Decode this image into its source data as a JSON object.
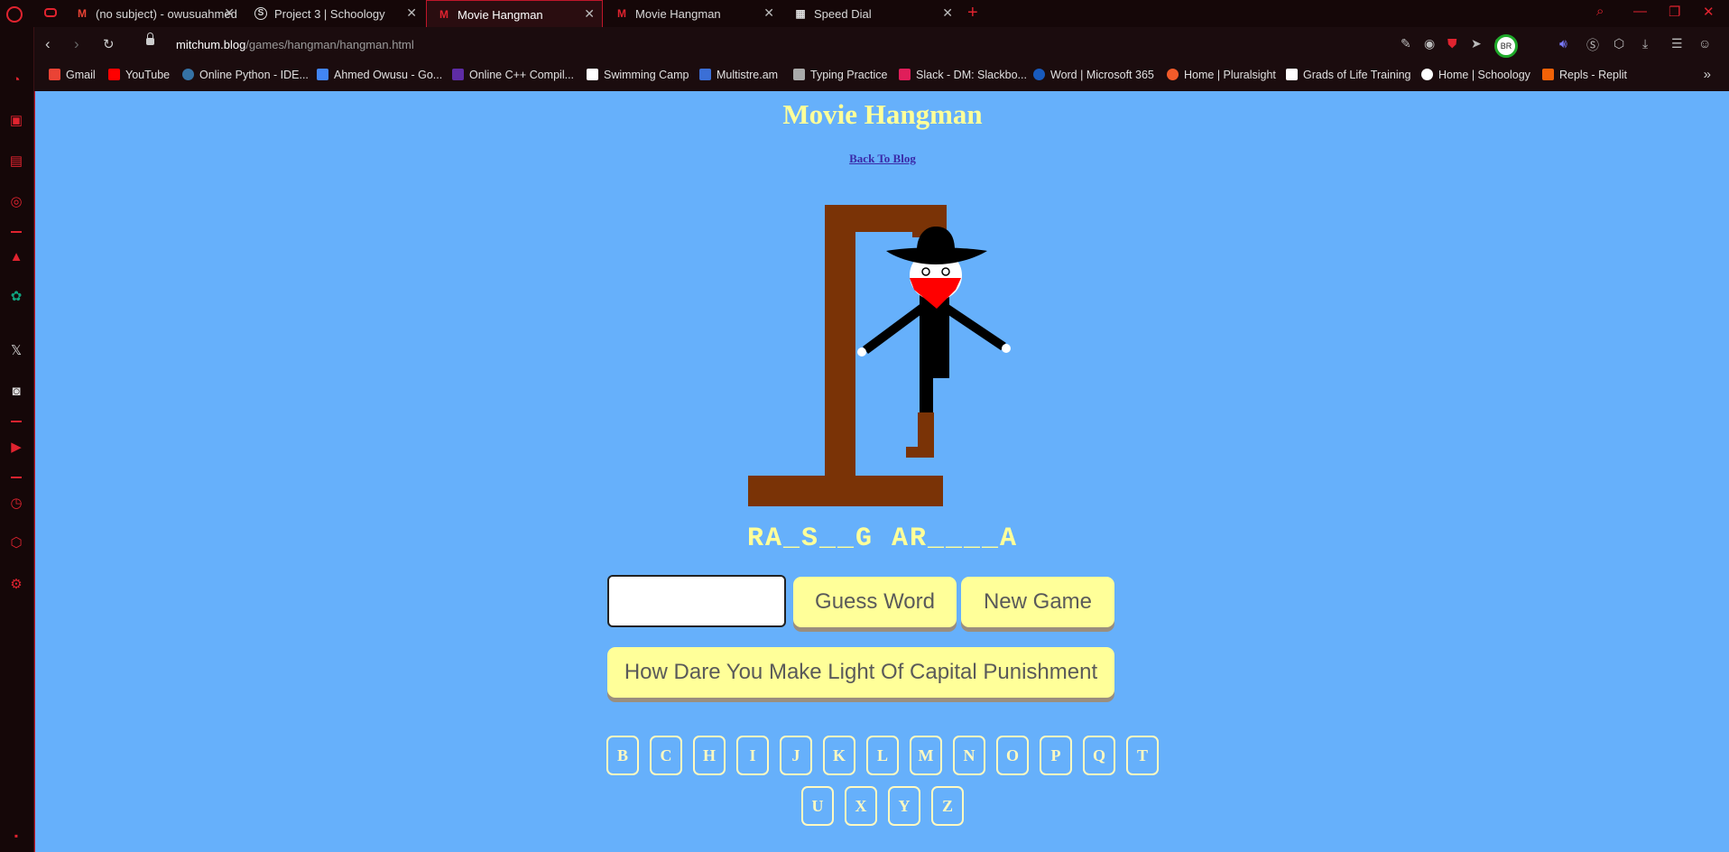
{
  "browser": {
    "tabs": [
      {
        "title": "(no subject) - owusuahmed",
        "icon": "gmail-icon",
        "active": false
      },
      {
        "title": "Project 3 | Schoology",
        "icon": "schoology-icon",
        "active": false
      },
      {
        "title": "Movie Hangman",
        "icon": "hangman-favicon",
        "active": true
      },
      {
        "title": "Movie Hangman",
        "icon": "hangman-favicon",
        "active": false
      },
      {
        "title": "Speed Dial",
        "icon": "speed-dial-icon",
        "active": false
      }
    ],
    "url_domain": "mitchum.blog",
    "url_path": "/games/hangman/hangman.html",
    "profile_initials": "BR",
    "bookmarks": [
      {
        "label": "Gmail",
        "color": "#ea4335"
      },
      {
        "label": "YouTube",
        "color": "#ff0000"
      },
      {
        "label": "Online Python - IDE...",
        "color": "#3572a5"
      },
      {
        "label": "Ahmed Owusu - Go...",
        "color": "#4285f4"
      },
      {
        "label": "Online C++ Compil...",
        "color": "#5e2ca5"
      },
      {
        "label": "Swimming Camp",
        "color": "#ffffff"
      },
      {
        "label": "Multistre.am",
        "color": "#3b6fd6"
      },
      {
        "label": "Typing Practice",
        "color": "#aaaaaa"
      },
      {
        "label": "Slack - DM: Slackbo...",
        "color": "#e01e5a"
      },
      {
        "label": "Word | Microsoft 365",
        "color": "#185abd"
      },
      {
        "label": "Home | Pluralsight",
        "color": "#f15b2a"
      },
      {
        "label": "Grads of Life Training",
        "color": "#ffffff"
      },
      {
        "label": "Home | Schoology",
        "color": "#ffffff"
      },
      {
        "label": "Repls - Replit",
        "color": "#f26207"
      }
    ]
  },
  "game": {
    "title": "Movie Hangman",
    "back_link": "Back To Blog",
    "masked_word": "RA_S__G AR____A",
    "input_value": "",
    "guess_button": "Guess Word",
    "new_game_button": "New Game",
    "hint_button": "How Dare You Make Light Of Capital Punishment",
    "letters_row1": [
      "B",
      "C",
      "H",
      "I",
      "J",
      "K",
      "L",
      "M",
      "N",
      "O",
      "P",
      "Q",
      "T"
    ],
    "letters_row2": [
      "U",
      "X",
      "Y",
      "Z"
    ]
  },
  "colors": {
    "page_background": "#66b0fb",
    "accent_yellow": "#ffff99",
    "gallows_brown": "#7a3306",
    "bandana_red": "#ff0000",
    "browser_accent": "#e0232f"
  }
}
